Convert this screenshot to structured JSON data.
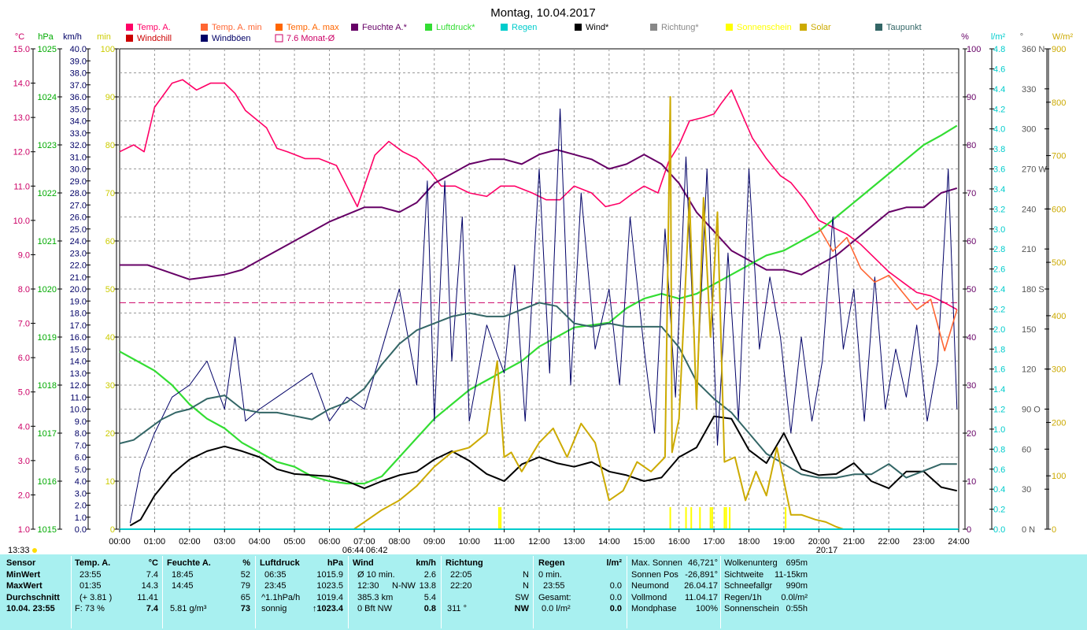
{
  "window_title": "Montag, 10.04.2017",
  "chart_data": {
    "type": "line",
    "title": "Montag, 10.04.2017",
    "x_ticks": [
      "00:00",
      "01:00",
      "02:00",
      "03:00",
      "04:00",
      "05:00",
      "06:00",
      "07:00",
      "08:00",
      "09:00",
      "10:00",
      "11:00",
      "12:00",
      "13:00",
      "14:00",
      "15:00",
      "16:00",
      "17:00",
      "18:00",
      "19:00",
      "20:00",
      "21:00",
      "22:00",
      "23:00",
      "24:00"
    ],
    "axis_units": {
      "temp": "°C",
      "pressure": "hPa",
      "wind": "km/h",
      "minutes": "min",
      "humidity": "%",
      "rain": "l/m²",
      "direction": "°",
      "solar": "W/m²"
    },
    "temp_ticks": [
      "1.0",
      "2.0",
      "3.0",
      "4.0",
      "5.0",
      "6.0",
      "7.0",
      "8.0",
      "9.0",
      "10.0",
      "11.0",
      "12.0",
      "13.0",
      "14.0",
      "15.0"
    ],
    "pressure_ticks": [
      "1015",
      "1016",
      "1017",
      "1018",
      "1019",
      "1020",
      "1021",
      "1022",
      "1023",
      "1024",
      "1025"
    ],
    "wind_ticks": [
      "0.0",
      "1.0",
      "2.0",
      "3.0",
      "4.0",
      "5.0",
      "6.0",
      "7.0",
      "8.0",
      "9.0",
      "10.0",
      "11.0",
      "12.0",
      "13.0",
      "14.0",
      "15.0",
      "16.0",
      "17.0",
      "18.0",
      "19.0",
      "20.0",
      "21.0",
      "22.0",
      "23.0",
      "24.0",
      "25.0",
      "26.0",
      "27.0",
      "28.0",
      "29.0",
      "30.0",
      "31.0",
      "32.0",
      "33.0",
      "34.0",
      "35.0",
      "36.0",
      "37.0",
      "38.0",
      "39.0",
      "40.0"
    ],
    "min_ticks": [
      "0",
      "10",
      "20",
      "30",
      "40",
      "50",
      "60",
      "70",
      "80",
      "90",
      "100"
    ],
    "hum_ticks": [
      "0",
      "10",
      "20",
      "30",
      "40",
      "50",
      "60",
      "70",
      "80",
      "90",
      "100"
    ],
    "rain_ticks": [
      "0.0",
      "0.2",
      "0.4",
      "0.6",
      "0.8",
      "1.0",
      "1.2",
      "1.4",
      "1.6",
      "1.8",
      "2.0",
      "2.2",
      "2.4",
      "2.6",
      "2.8",
      "3.0",
      "3.2",
      "3.4",
      "3.6",
      "3.8",
      "4.0",
      "4.2",
      "4.4",
      "4.6",
      "4.8"
    ],
    "dir_ticks": [
      "0 N",
      "30",
      "60",
      "90 O",
      "120",
      "150",
      "180 S",
      "210",
      "240",
      "270 W",
      "300",
      "330",
      "360 N"
    ],
    "solar_ticks": [
      "0",
      "100",
      "200",
      "300",
      "400",
      "500",
      "600",
      "700",
      "800",
      "900"
    ],
    "legend": [
      {
        "label": "Temp. A.",
        "color": "#ff0066"
      },
      {
        "label": "Temp. A. min",
        "color": "#ff6633"
      },
      {
        "label": "Temp. A. max",
        "color": "#ff6600"
      },
      {
        "label": "Feuchte A.*",
        "color": "#660066"
      },
      {
        "label": "Luftdruck*",
        "color": "#33dd33"
      },
      {
        "label": "Regen",
        "color": "#00cccc"
      },
      {
        "label": "Wind*",
        "color": "#000000"
      },
      {
        "label": "Richtung*",
        "color": "#888888"
      },
      {
        "label": "Sonnenschein",
        "color": "#ffff00"
      },
      {
        "label": "Solar",
        "color": "#ccaa00"
      },
      {
        "label": "Taupunkt",
        "color": "#336666"
      },
      {
        "label": "Windchill",
        "color": "#cc0000"
      },
      {
        "label": "Windböen",
        "color": "#000066"
      },
      {
        "label": "7.6 Monat-Ø",
        "color": "#cc0066"
      }
    ],
    "series": [
      {
        "name": "Temp. A.",
        "axis": "temp",
        "x": [
          0,
          0.4,
          0.7,
          1.0,
          1.5,
          1.8,
          2.2,
          2.6,
          3.0,
          3.3,
          3.6,
          4.2,
          4.5,
          4.8,
          5.3,
          5.7,
          6.2,
          6.5,
          6.8,
          7.0,
          7.3,
          7.7,
          8.1,
          8.5,
          8.9,
          9.2,
          9.6,
          10.0,
          10.5,
          10.9,
          11.3,
          11.8,
          12.2,
          12.6,
          13.0,
          13.5,
          13.9,
          14.3,
          14.7,
          15.0,
          15.4,
          15.7,
          16.0,
          16.3,
          16.7,
          17.0,
          17.2,
          17.5,
          17.8,
          18.1,
          18.5,
          18.9,
          19.2,
          19.6,
          20.0,
          20.4,
          20.8,
          21.2,
          21.6,
          22.0,
          22.4,
          22.8,
          23.2,
          23.6,
          23.95
        ],
        "y": [
          12.0,
          12.2,
          12.0,
          13.3,
          14.0,
          14.1,
          13.8,
          14.0,
          14.0,
          13.7,
          13.2,
          12.7,
          12.1,
          12.0,
          11.8,
          11.8,
          11.6,
          11.0,
          10.4,
          11.0,
          11.9,
          12.3,
          12.0,
          11.8,
          11.4,
          11.0,
          11.0,
          10.8,
          10.7,
          11.0,
          11.0,
          10.8,
          10.6,
          10.6,
          11.0,
          10.8,
          10.4,
          10.5,
          10.8,
          11.0,
          10.8,
          11.7,
          12.2,
          12.9,
          13.0,
          13.1,
          13.4,
          13.8,
          13.1,
          12.4,
          11.8,
          11.3,
          11.1,
          10.6,
          10.0,
          9.8,
          9.6,
          9.3,
          8.9,
          8.5,
          8.2,
          7.9,
          7.8,
          7.6,
          7.4
        ]
      },
      {
        "name": "Feuchte A.*",
        "axis": "hum",
        "x": [
          0,
          0.8,
          1.2,
          2.0,
          3.0,
          3.5,
          4.0,
          5.0,
          6.0,
          7.0,
          7.5,
          8.0,
          8.5,
          9.0,
          9.5,
          10.0,
          10.6,
          11.0,
          11.5,
          12.0,
          12.5,
          13.0,
          13.5,
          14.0,
          14.5,
          15.0,
          15.5,
          16.0,
          16.5,
          17.0,
          17.5,
          18.0,
          18.5,
          19.0,
          19.5,
          20.0,
          20.5,
          21.0,
          21.5,
          22.0,
          22.5,
          23.0,
          23.5,
          23.95
        ],
        "y": [
          55,
          55,
          54,
          52,
          53,
          54,
          56,
          60,
          64,
          67,
          67,
          66,
          68,
          72,
          74,
          76,
          77,
          77,
          76,
          78,
          79,
          78,
          77,
          75,
          76,
          78,
          76,
          72,
          66,
          62,
          58,
          56,
          54,
          54,
          53,
          55,
          57,
          60,
          63,
          66,
          67,
          67,
          70,
          71
        ]
      },
      {
        "name": "Luftdruck*",
        "axis": "pressure",
        "x": [
          0,
          0.5,
          1.0,
          1.5,
          2.0,
          2.5,
          3.0,
          3.5,
          4.0,
          4.5,
          5.0,
          5.5,
          6.0,
          6.5,
          7.0,
          7.5,
          8.0,
          8.5,
          9.0,
          9.5,
          10.0,
          10.5,
          11.0,
          11.5,
          12.0,
          12.5,
          13.0,
          13.5,
          14.0,
          14.5,
          15.0,
          15.5,
          16.0,
          16.5,
          17.0,
          17.5,
          18.0,
          18.5,
          19.0,
          19.5,
          20.0,
          20.5,
          21.0,
          21.5,
          22.0,
          22.5,
          23.0,
          23.5,
          23.95
        ],
        "y": [
          1018.7,
          1018.5,
          1018.3,
          1018.0,
          1017.6,
          1017.3,
          1017.1,
          1016.8,
          1016.6,
          1016.4,
          1016.3,
          1016.1,
          1016.0,
          1015.95,
          1015.95,
          1016.1,
          1016.5,
          1016.9,
          1017.3,
          1017.6,
          1017.9,
          1018.1,
          1018.3,
          1018.5,
          1018.8,
          1019.0,
          1019.2,
          1019.25,
          1019.3,
          1019.6,
          1019.8,
          1019.9,
          1019.8,
          1019.9,
          1020.1,
          1020.3,
          1020.5,
          1020.7,
          1020.8,
          1021.0,
          1021.2,
          1021.5,
          1021.8,
          1022.1,
          1022.4,
          1022.7,
          1023.0,
          1023.2,
          1023.4
        ]
      },
      {
        "name": "Wind*",
        "axis": "wind",
        "x": [
          0.3,
          0.6,
          1.0,
          1.5,
          2.0,
          2.5,
          3.0,
          3.5,
          4.0,
          4.5,
          5.0,
          5.5,
          6.0,
          6.5,
          7.0,
          7.5,
          8.0,
          8.5,
          9.0,
          9.5,
          10.0,
          10.5,
          11.0,
          11.5,
          12.0,
          12.5,
          13.0,
          13.5,
          14.0,
          14.5,
          15.0,
          15.5,
          16.0,
          16.5,
          17.0,
          17.5,
          18.0,
          18.5,
          19.0,
          19.5,
          20.0,
          20.5,
          21.0,
          21.5,
          22.0,
          22.5,
          23.0,
          23.5,
          23.95
        ],
        "y": [
          0.3,
          0.8,
          2.8,
          4.6,
          5.8,
          6.5,
          6.9,
          6.5,
          6.0,
          5.0,
          4.6,
          4.5,
          4.4,
          4.0,
          3.4,
          4.0,
          4.5,
          4.8,
          5.8,
          6.5,
          5.7,
          4.6,
          4.0,
          5.4,
          6.0,
          5.5,
          5.2,
          5.6,
          4.8,
          4.5,
          4.0,
          4.3,
          6.0,
          6.8,
          9.4,
          9.2,
          6.6,
          5.5,
          8.0,
          5.0,
          4.5,
          4.6,
          5.5,
          4.0,
          3.4,
          4.8,
          4.8,
          3.5,
          3.2
        ]
      },
      {
        "name": "Windböen",
        "axis": "wind",
        "x": [
          0.3,
          0.6,
          1.0,
          1.5,
          2.0,
          2.5,
          3.0,
          3.3,
          3.6,
          4.0,
          4.5,
          5.0,
          5.5,
          6.0,
          6.5,
          7.0,
          7.5,
          8.0,
          8.5,
          8.8,
          9.0,
          9.3,
          9.5,
          9.8,
          10.0,
          10.5,
          11.0,
          11.3,
          11.6,
          12.0,
          12.3,
          12.6,
          12.9,
          13.2,
          13.6,
          14.0,
          14.3,
          14.6,
          15.0,
          15.3,
          15.6,
          15.9,
          16.2,
          16.5,
          16.8,
          17.1,
          17.4,
          17.7,
          18.0,
          18.3,
          18.6,
          18.9,
          19.2,
          19.5,
          19.8,
          20.1,
          20.4,
          20.7,
          21.0,
          21.3,
          21.6,
          21.9,
          22.2,
          22.5,
          22.8,
          23.1,
          23.4,
          23.7,
          23.95
        ],
        "y": [
          0.5,
          5.0,
          8.0,
          11.0,
          12.0,
          14.0,
          10.0,
          16.0,
          9.0,
          10.0,
          11.0,
          12.0,
          13.0,
          9.0,
          11.0,
          10.0,
          15.0,
          20.0,
          12.0,
          29.0,
          9.0,
          29.0,
          14.0,
          26.0,
          9.0,
          17.0,
          13.0,
          22.0,
          9.0,
          30.0,
          13.0,
          35.0,
          12.0,
          28.0,
          15.0,
          20.0,
          12.0,
          26.0,
          15.0,
          8.0,
          25.0,
          11.0,
          31.0,
          11.0,
          30.0,
          7.0,
          23.0,
          9.0,
          30.0,
          15.0,
          21.0,
          16.0,
          8.0,
          16.0,
          9.0,
          14.0,
          26.0,
          15.0,
          20.0,
          9.0,
          21.0,
          10.0,
          15.0,
          11.0,
          17.0,
          9.0,
          14.0,
          30.0,
          10.0
        ]
      },
      {
        "name": "Taupunkt",
        "axis": "temp",
        "x": [
          0,
          0.4,
          0.8,
          1.2,
          1.6,
          2.0,
          2.5,
          3.0,
          3.5,
          4.0,
          4.5,
          5.0,
          5.5,
          6.0,
          6.5,
          7.0,
          7.5,
          8.0,
          8.5,
          9.0,
          9.5,
          10.0,
          10.5,
          11.0,
          11.5,
          12.0,
          12.5,
          13.0,
          13.5,
          14.0,
          14.5,
          15.0,
          15.5,
          16.0,
          16.5,
          17.0,
          17.5,
          18.0,
          18.5,
          19.0,
          19.5,
          20.0,
          20.5,
          21.0,
          21.5,
          22.0,
          22.5,
          23.0,
          23.5,
          23.95
        ],
        "y": [
          3.5,
          3.6,
          3.9,
          4.2,
          4.4,
          4.5,
          4.8,
          4.9,
          4.5,
          4.4,
          4.4,
          4.3,
          4.2,
          4.5,
          4.7,
          5.1,
          5.8,
          6.4,
          6.8,
          7.0,
          7.2,
          7.3,
          7.2,
          7.2,
          7.4,
          7.6,
          7.5,
          7.0,
          6.9,
          7.0,
          6.9,
          6.9,
          6.9,
          6.3,
          5.3,
          4.8,
          4.4,
          3.8,
          3.2,
          2.9,
          2.6,
          2.5,
          2.5,
          2.6,
          2.6,
          2.9,
          2.5,
          2.7,
          2.9,
          2.9
        ]
      },
      {
        "name": "Solar",
        "axis": "solar",
        "x": [
          0,
          6.7,
          7.0,
          7.5,
          8.0,
          8.5,
          9.0,
          9.5,
          10.0,
          10.5,
          10.8,
          11.0,
          11.2,
          11.5,
          12.0,
          12.4,
          12.8,
          13.2,
          13.6,
          14.0,
          14.4,
          14.8,
          15.2,
          15.6,
          15.75,
          15.8,
          16.0,
          16.3,
          16.5,
          16.7,
          16.9,
          17.1,
          17.3,
          17.6,
          17.9,
          18.2,
          18.5,
          18.8,
          19.2,
          19.5,
          19.9,
          20.2,
          20.5,
          20.7,
          24
        ],
        "y": [
          0,
          0,
          15,
          40,
          60,
          90,
          130,
          160,
          170,
          200,
          350,
          150,
          160,
          120,
          180,
          210,
          150,
          220,
          180,
          60,
          80,
          140,
          120,
          150,
          900,
          160,
          230,
          690,
          250,
          690,
          400,
          660,
          140,
          150,
          60,
          120,
          70,
          170,
          30,
          30,
          20,
          15,
          5,
          0,
          0
        ]
      },
      {
        "name": "Temp. A. min",
        "axis": "temp",
        "x": [
          20.0,
          20.4,
          20.8,
          21.2,
          21.6,
          22.0,
          22.4,
          22.8,
          23.2,
          23.6,
          23.95
        ],
        "y": [
          9.8,
          9.1,
          9.5,
          8.6,
          8.2,
          8.4,
          7.9,
          7.4,
          7.7,
          6.2,
          7.4
        ]
      }
    ],
    "monthly_avg": {
      "label": "7.6 Monat-Ø",
      "value": 7.6
    },
    "sunshine_hours": [
      10.85,
      10.9,
      15.75,
      16.2,
      16.35,
      16.6,
      16.9,
      16.95,
      17.3,
      17.35,
      17.45,
      19.05
    ],
    "x_marks": {
      "sunrise": "06:44",
      "solar_noon": "06:42",
      "sunset": "20:17",
      "current": "13:33"
    }
  },
  "panel": {
    "sensor": {
      "header": "Sensor",
      "rows": [
        "MinWert",
        "MaxWert",
        "Durchschnitt",
        "10.04.  23:55"
      ]
    },
    "temp": {
      "header": "Temp. A.",
      "unit": "°C",
      "rows": [
        [
          "23:55",
          "7.4"
        ],
        [
          "01:35",
          "14.3"
        ],
        [
          "(+ 3.81 )",
          "11.41"
        ],
        [
          "F: 73 %",
          "7.4"
        ]
      ]
    },
    "hum": {
      "header": "Feuchte A.",
      "unit": "%",
      "rows": [
        [
          "18:45",
          "52"
        ],
        [
          "14:45",
          "79"
        ],
        [
          "",
          "65"
        ],
        [
          "5.81 g/m³",
          "73"
        ]
      ]
    },
    "pressure": {
      "header": "Luftdruck",
      "unit": "hPa",
      "rows": [
        [
          "06:35",
          "1015.9"
        ],
        [
          "23:45",
          "1023.5"
        ],
        [
          "^1.1hPa/h",
          "1019.4"
        ],
        [
          "sonnig",
          "↑1023.4"
        ]
      ]
    },
    "wind": {
      "header": "Wind",
      "unit": "km/h",
      "rows": [
        [
          "Ø 10 min.",
          "",
          "2.6"
        ],
        [
          "12:30",
          "N-NW",
          "13.8"
        ],
        [
          "385.3 km",
          "",
          "5.4"
        ],
        [
          "0 Bft NW",
          "",
          "0.8"
        ]
      ]
    },
    "dir": {
      "header": "Richtung",
      "rows": [
        [
          "22:05",
          "N"
        ],
        [
          "22:20",
          "N"
        ],
        [
          "",
          "SW"
        ],
        [
          "311 °",
          "NW"
        ]
      ]
    },
    "rain": {
      "header": "Regen",
      "unit": "l/m²",
      "rows": [
        [
          "0 min.",
          ""
        ],
        [
          "23:55",
          "0.0"
        ],
        [
          "Gesamt:",
          "0.0"
        ],
        [
          "0.0 l/m²",
          "0.0"
        ]
      ]
    },
    "astro": {
      "rows": [
        [
          "Max. Sonnen",
          "46,721°"
        ],
        [
          "Sonnen Pos",
          "-26,891°"
        ],
        [
          "Neumond",
          "26.04.17"
        ],
        [
          "Vollmond",
          "11.04.17"
        ],
        [
          "Mondphase",
          "100%"
        ]
      ]
    },
    "misc": {
      "rows": [
        [
          "Wolkenunterg",
          "695m"
        ],
        [
          "Sichtweite",
          "11-15km"
        ],
        [
          "Schneefallgr",
          "990m"
        ],
        [
          "Regen/1h",
          "0.0l/m²"
        ],
        [
          "Sonnenschein",
          "0:55h"
        ]
      ]
    }
  }
}
